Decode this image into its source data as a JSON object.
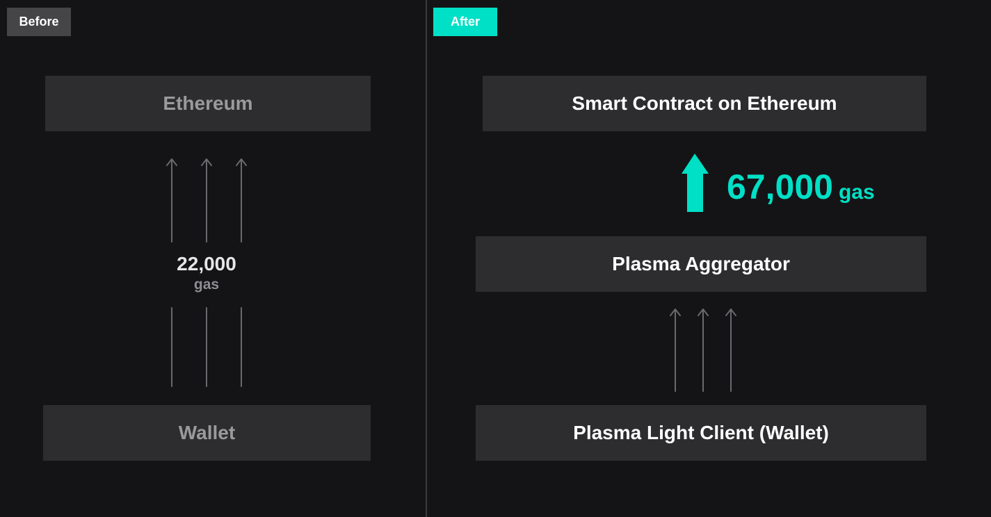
{
  "before": {
    "tag": "Before",
    "top_label": "Ethereum",
    "bottom_label": "Wallet",
    "gas_value": "22,000",
    "gas_unit": "gas"
  },
  "after": {
    "tag": "After",
    "top_label": "Smart Contract on Ethereum",
    "middle_label": "Plasma Aggregator",
    "bottom_label": "Plasma Light Client (Wallet)",
    "gas_value": "67,000",
    "gas_unit": "gas"
  },
  "colors": {
    "accent": "#00e0c6",
    "background": "#141416",
    "box": "#2d2d2f",
    "arrow": "#6a6a6e"
  },
  "icons": {
    "thin_arrows": "arrow-up-thin-icon",
    "big_arrow": "arrow-up-bold-icon"
  }
}
